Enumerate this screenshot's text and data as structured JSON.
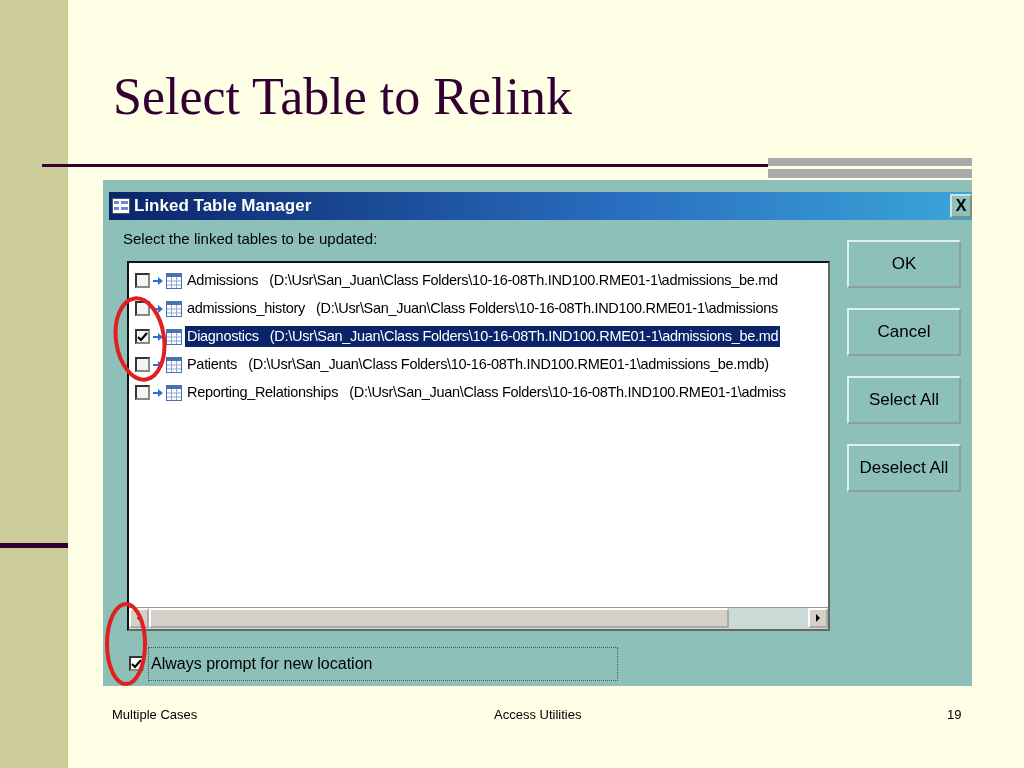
{
  "slide": {
    "title": "Select Table to Relink"
  },
  "dialog": {
    "title": "Linked Table Manager",
    "close": "X",
    "prompt": "Select the linked tables to be updated:",
    "tables": [
      {
        "label": "Admissions   (D:\\Usr\\San_Juan\\Class Folders\\10-16-08Th.IND100.RME01-1\\admissions_be.md",
        "checked": false,
        "selected": false
      },
      {
        "label": "admissions_history   (D:\\Usr\\San_Juan\\Class Folders\\10-16-08Th.IND100.RME01-1\\admissions",
        "checked": false,
        "selected": false
      },
      {
        "label": "Diagnostics   (D:\\Usr\\San_Juan\\Class Folders\\10-16-08Th.IND100.RME01-1\\admissions_be.md",
        "checked": true,
        "selected": true
      },
      {
        "label": "Patients   (D:\\Usr\\San_Juan\\Class Folders\\10-16-08Th.IND100.RME01-1\\admissions_be.mdb)",
        "checked": false,
        "selected": false
      },
      {
        "label": "Reporting_Relationships   (D:\\Usr\\San_Juan\\Class Folders\\10-16-08Th.IND100.RME01-1\\admiss",
        "checked": false,
        "selected": false
      }
    ],
    "buttons": [
      "OK",
      "Cancel",
      "Select All",
      "Deselect All"
    ],
    "option": {
      "label": "Always prompt for new location",
      "checked": true
    }
  },
  "footer": {
    "left": "Multiple Cases",
    "center": "Access Utilities",
    "page": "19"
  }
}
